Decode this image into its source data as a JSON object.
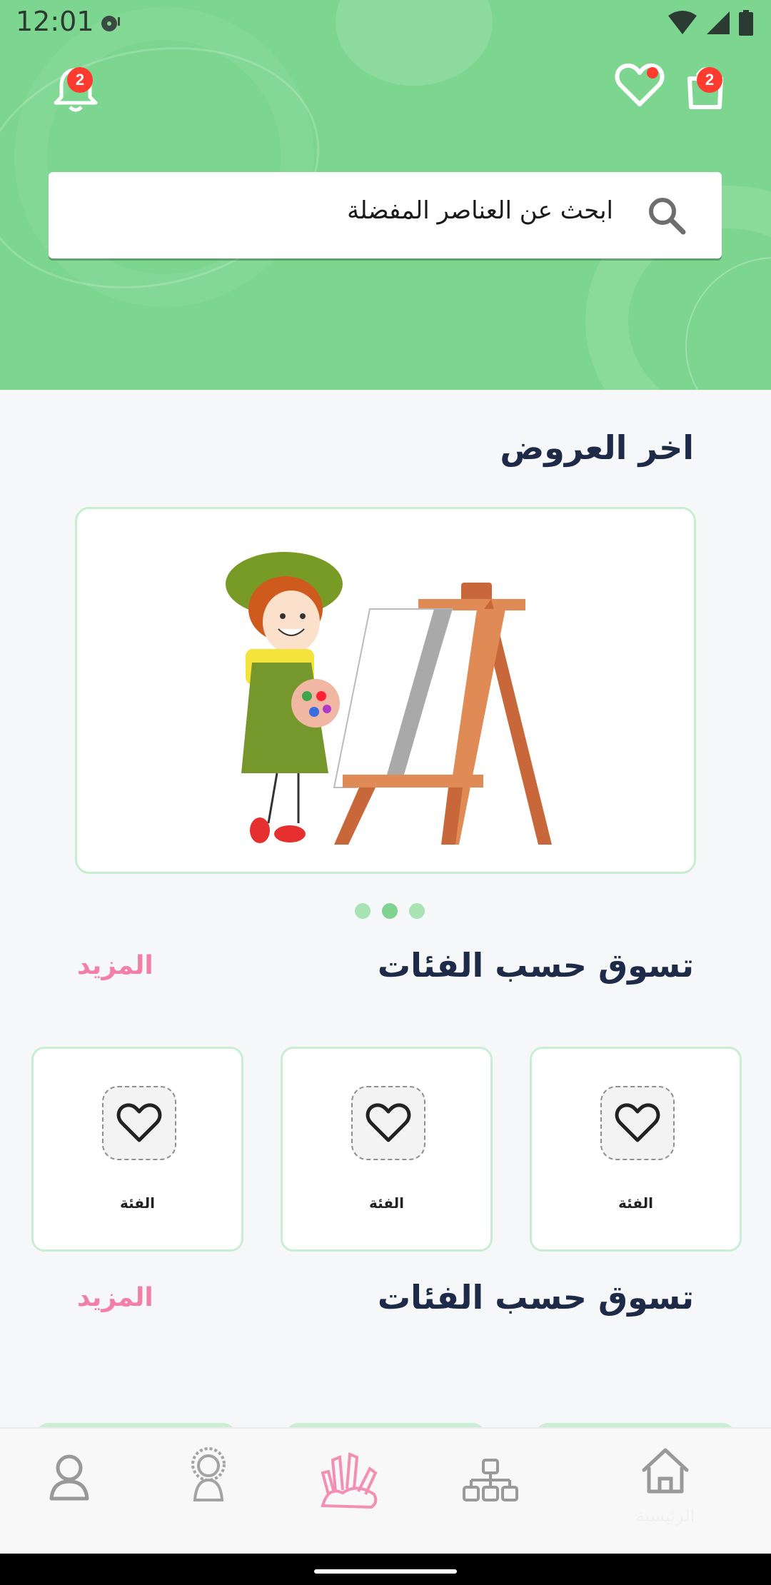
{
  "status_bar": {
    "time": "12:01"
  },
  "header": {
    "notifications_badge": "2",
    "cart_badge": "2",
    "search": {
      "placeholder": "ابحث عن العناصر المفضلة"
    }
  },
  "offers": {
    "title": "اخر العروض",
    "slide_count": 3,
    "active_slide": 2
  },
  "sections": [
    {
      "title": "تسوق حسب الفئات",
      "more_label": "المزيد"
    },
    {
      "title": "تسوق حسب الفئات",
      "more_label": "المزيد"
    }
  ],
  "categories": [
    {
      "label": "الفئة",
      "icon": "heart-icon"
    },
    {
      "label": "الفئة",
      "icon": "heart-icon"
    },
    {
      "label": "الفئة",
      "icon": "heart-icon"
    }
  ],
  "bottom_nav": {
    "home_label": "الرئيسية",
    "items": [
      "profile-icon",
      "kid-icon",
      "crafts-icon",
      "sitemap-icon",
      "home-icon"
    ]
  },
  "colors": {
    "header_bg": "#7dd68f",
    "title": "#1d2b48",
    "accent_pink": "#f27fa6",
    "badge": "#ff3b30"
  }
}
